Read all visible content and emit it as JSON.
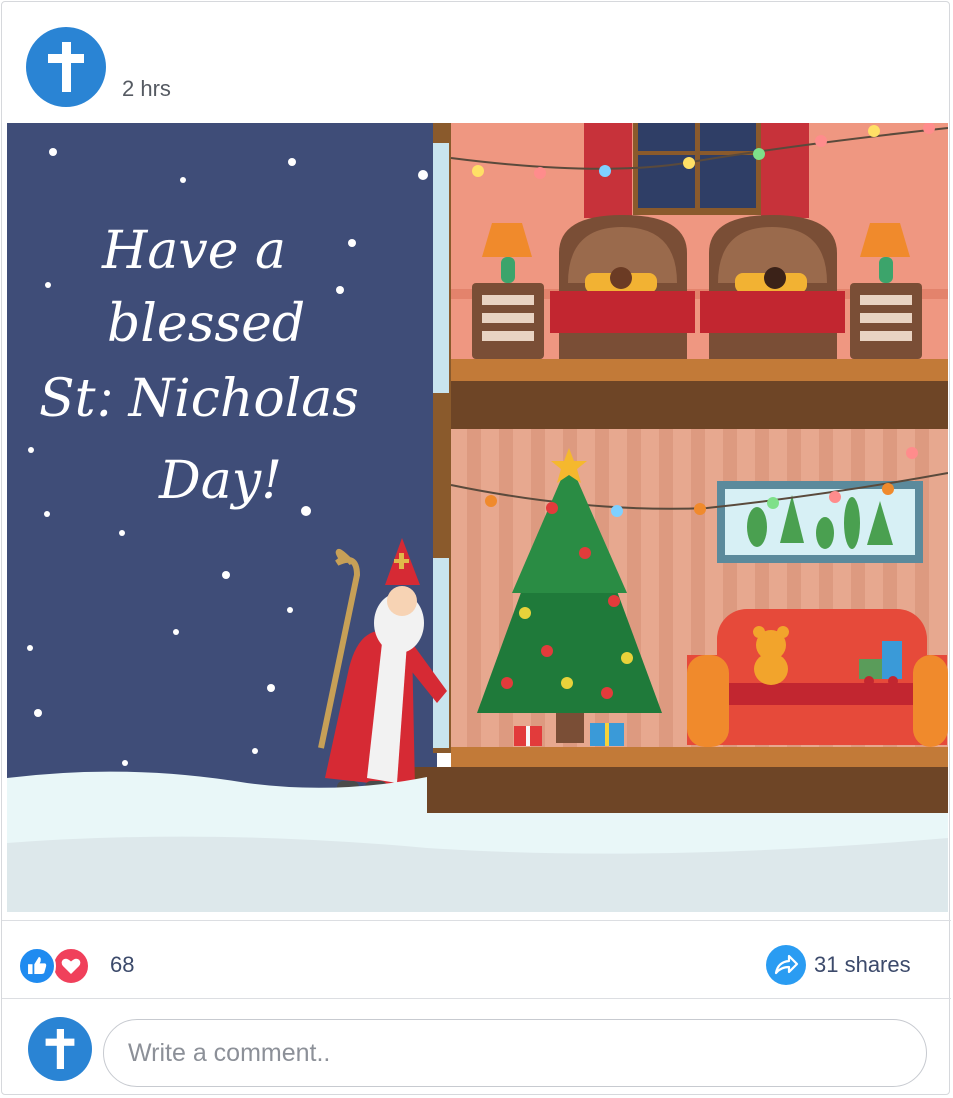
{
  "post": {
    "timestamp": "2 hrs",
    "image": {
      "greeting_lines": [
        "Have a",
        "blessed",
        "St. Nicholas",
        "Day!"
      ]
    }
  },
  "engagement": {
    "reaction_count": "68",
    "reactions": [
      "like-icon",
      "love-icon"
    ],
    "share_label": "31 shares"
  },
  "comment": {
    "placeholder": "Write a comment.."
  },
  "colors": {
    "brand_blue": "#2a84d4",
    "like_blue": "#1f8bf0",
    "love_red": "#f0405b",
    "night_sky": "#3f4d78"
  }
}
